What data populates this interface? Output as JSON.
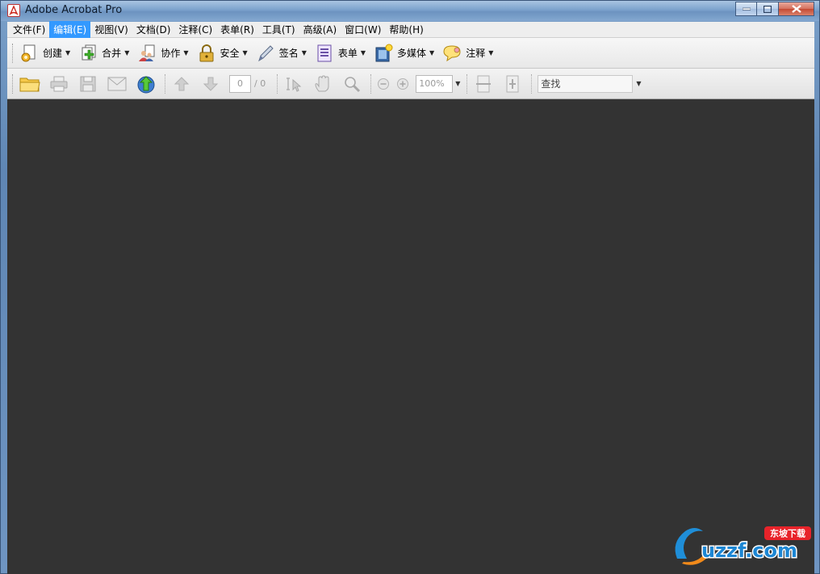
{
  "window": {
    "title": "Adobe Acrobat Pro"
  },
  "menu": [
    {
      "label": "文件(F)",
      "active": false
    },
    {
      "label": "编辑(E)",
      "active": true
    },
    {
      "label": "视图(V)",
      "active": false
    },
    {
      "label": "文档(D)",
      "active": false
    },
    {
      "label": "注释(C)",
      "active": false
    },
    {
      "label": "表单(R)",
      "active": false
    },
    {
      "label": "工具(T)",
      "active": false
    },
    {
      "label": "高级(A)",
      "active": false
    },
    {
      "label": "窗口(W)",
      "active": false
    },
    {
      "label": "帮助(H)",
      "active": false
    }
  ],
  "toolbar1": {
    "create": "创建",
    "combine": "合并",
    "collaborate": "协作",
    "secure": "安全",
    "sign": "签名",
    "forms": "表单",
    "multimedia": "多媒体",
    "comment": "注释"
  },
  "toolbar2": {
    "page_current": "0",
    "page_total": "/ 0",
    "zoom": "100%",
    "find_placeholder": "查找"
  },
  "watermark": {
    "text": "uzzf.com",
    "sub": "东坡下载"
  },
  "colors": {
    "accent": "#3399ff",
    "doc_bg": "#333333",
    "titlebar": "#7ba2cc"
  }
}
